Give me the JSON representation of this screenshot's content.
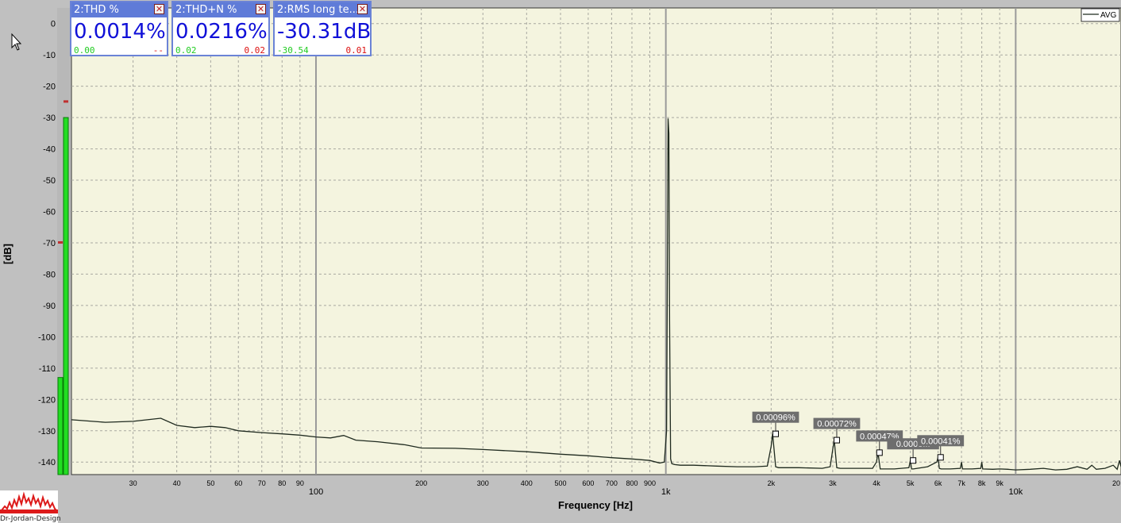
{
  "meters": [
    {
      "title": "2:THD %",
      "value": "0.0014%",
      "min": "0.00",
      "max": "--"
    },
    {
      "title": "2:THD+N %",
      "value": "0.0216%",
      "min": "0.02",
      "max": "0.02"
    },
    {
      "title": "2:RMS long te...",
      "value": "-30.31dB",
      "min": "-30.54",
      "max": "0.01"
    }
  ],
  "logo": {
    "text": "Dr-Jordan-Design"
  },
  "level_meter": {
    "bar1_top_db": -30,
    "bar2_top_db": -113,
    "peak_markers_db": [
      -25,
      -70
    ]
  },
  "colors": {
    "plot_bg": "#f4f4df",
    "trace": "#1f2a1f",
    "grid": "#a8a8a0",
    "accent": "#5f7bd8",
    "meter_green": "#22dd22"
  },
  "chart_data": {
    "type": "line",
    "xlabel": "Frequency [Hz]",
    "ylabel": "[dB]",
    "x_scale": "log",
    "xlim": [
      20,
      20000
    ],
    "ylim": [
      -144,
      5
    ],
    "grid": true,
    "legend_position": "top-right",
    "y_ticks": [
      0,
      -10,
      -20,
      -30,
      -40,
      -50,
      -60,
      -70,
      -80,
      -90,
      -100,
      -110,
      -120,
      -130,
      -140
    ],
    "x_ticks_major": [
      {
        "value": 100,
        "label": "100"
      },
      {
        "value": 1000,
        "label": "1k"
      },
      {
        "value": 10000,
        "label": "10k"
      }
    ],
    "x_ticks_minor": [
      {
        "value": 30,
        "label": "30"
      },
      {
        "value": 40,
        "label": "40"
      },
      {
        "value": 50,
        "label": "50"
      },
      {
        "value": 60,
        "label": "60"
      },
      {
        "value": 70,
        "label": "70"
      },
      {
        "value": 80,
        "label": "80"
      },
      {
        "value": 90,
        "label": "90"
      },
      {
        "value": 200,
        "label": "200"
      },
      {
        "value": 300,
        "label": "300"
      },
      {
        "value": 400,
        "label": "400"
      },
      {
        "value": 500,
        "label": "500"
      },
      {
        "value": 600,
        "label": "600"
      },
      {
        "value": 700,
        "label": "700"
      },
      {
        "value": 800,
        "label": "800"
      },
      {
        "value": 900,
        "label": "900"
      },
      {
        "value": 2000,
        "label": "2k"
      },
      {
        "value": 3000,
        "label": "3k"
      },
      {
        "value": 4000,
        "label": "4k"
      },
      {
        "value": 5000,
        "label": "5k"
      },
      {
        "value": 6000,
        "label": "6k"
      },
      {
        "value": 7000,
        "label": "7k"
      },
      {
        "value": 8000,
        "label": "8k"
      },
      {
        "value": 9000,
        "label": "9k"
      },
      {
        "value": 20000,
        "label": "20"
      }
    ],
    "series": [
      {
        "name": "AVG",
        "x": [
          20,
          25,
          30,
          36,
          40,
          45,
          50,
          55,
          60,
          70,
          80,
          90,
          100,
          110,
          120,
          130,
          150,
          180,
          200,
          250,
          300,
          400,
          500,
          600,
          700,
          800,
          900,
          960,
          990,
          1005,
          1010,
          1015,
          1020,
          1025,
          1032,
          1040,
          1060,
          1100,
          1200,
          1400,
          1600,
          1800,
          1950,
          2000,
          2020,
          2060,
          2100,
          2400,
          2800,
          2950,
          3000,
          3030,
          3080,
          3150,
          3500,
          3900,
          4000,
          4040,
          4100,
          4500,
          4950,
          5000,
          5040,
          5100,
          5600,
          5950,
          6000,
          6050,
          6120,
          6500,
          6950,
          7000,
          7050,
          7500,
          7950,
          8000,
          8050,
          8600,
          9000,
          9500,
          10000,
          11000,
          12000,
          13000,
          14000,
          15000,
          16000,
          16500,
          17000,
          18000,
          19000,
          19500,
          19800,
          20000
        ],
        "y": [
          -126.5,
          -127.3,
          -127.0,
          -126.0,
          -128.3,
          -129.0,
          -128.6,
          -129.0,
          -130.0,
          -130.6,
          -131.0,
          -131.4,
          -132.0,
          -132.3,
          -131.5,
          -133.0,
          -133.5,
          -134.5,
          -135.5,
          -135.6,
          -136.0,
          -136.7,
          -137.5,
          -138.0,
          -138.6,
          -139.0,
          -139.5,
          -140.3,
          -140.0,
          -130,
          -80,
          -30.31,
          -35,
          -95,
          -139,
          -140.5,
          -140.8,
          -141.0,
          -141.0,
          -141.3,
          -141.5,
          -141.5,
          -141.3,
          -135,
          -131,
          -141.5,
          -141.8,
          -141.8,
          -142.0,
          -141.5,
          -136,
          -133,
          -141.8,
          -142.0,
          -142.0,
          -142.0,
          -140,
          -137,
          -142.2,
          -142.2,
          -141.8,
          -139.5,
          -142.2,
          -142.2,
          -141.5,
          -140,
          -138.5,
          -142.0,
          -142.2,
          -142.2,
          -142.0,
          -140,
          -142.2,
          -142.2,
          -142.0,
          -140,
          -142.2,
          -142.3,
          -142.2,
          -142.3,
          -142.5,
          -142.3,
          -142.0,
          -142.5,
          -142.3,
          -141.5,
          -142.3,
          -141.0,
          -142.3,
          -142.0,
          -141.0,
          -142.3,
          -139.5,
          -141.5
        ]
      }
    ],
    "annotations": [
      {
        "x": 2060,
        "y": -131,
        "text": "0.00096%"
      },
      {
        "x": 3080,
        "y": -133,
        "text": "0.00072%"
      },
      {
        "x": 4080,
        "y": -137,
        "text": "0.00047%"
      },
      {
        "x": 5090,
        "y": -139.5,
        "text": "0.0003..."
      },
      {
        "x": 6100,
        "y": -138.5,
        "text": "0.00041%"
      }
    ]
  }
}
